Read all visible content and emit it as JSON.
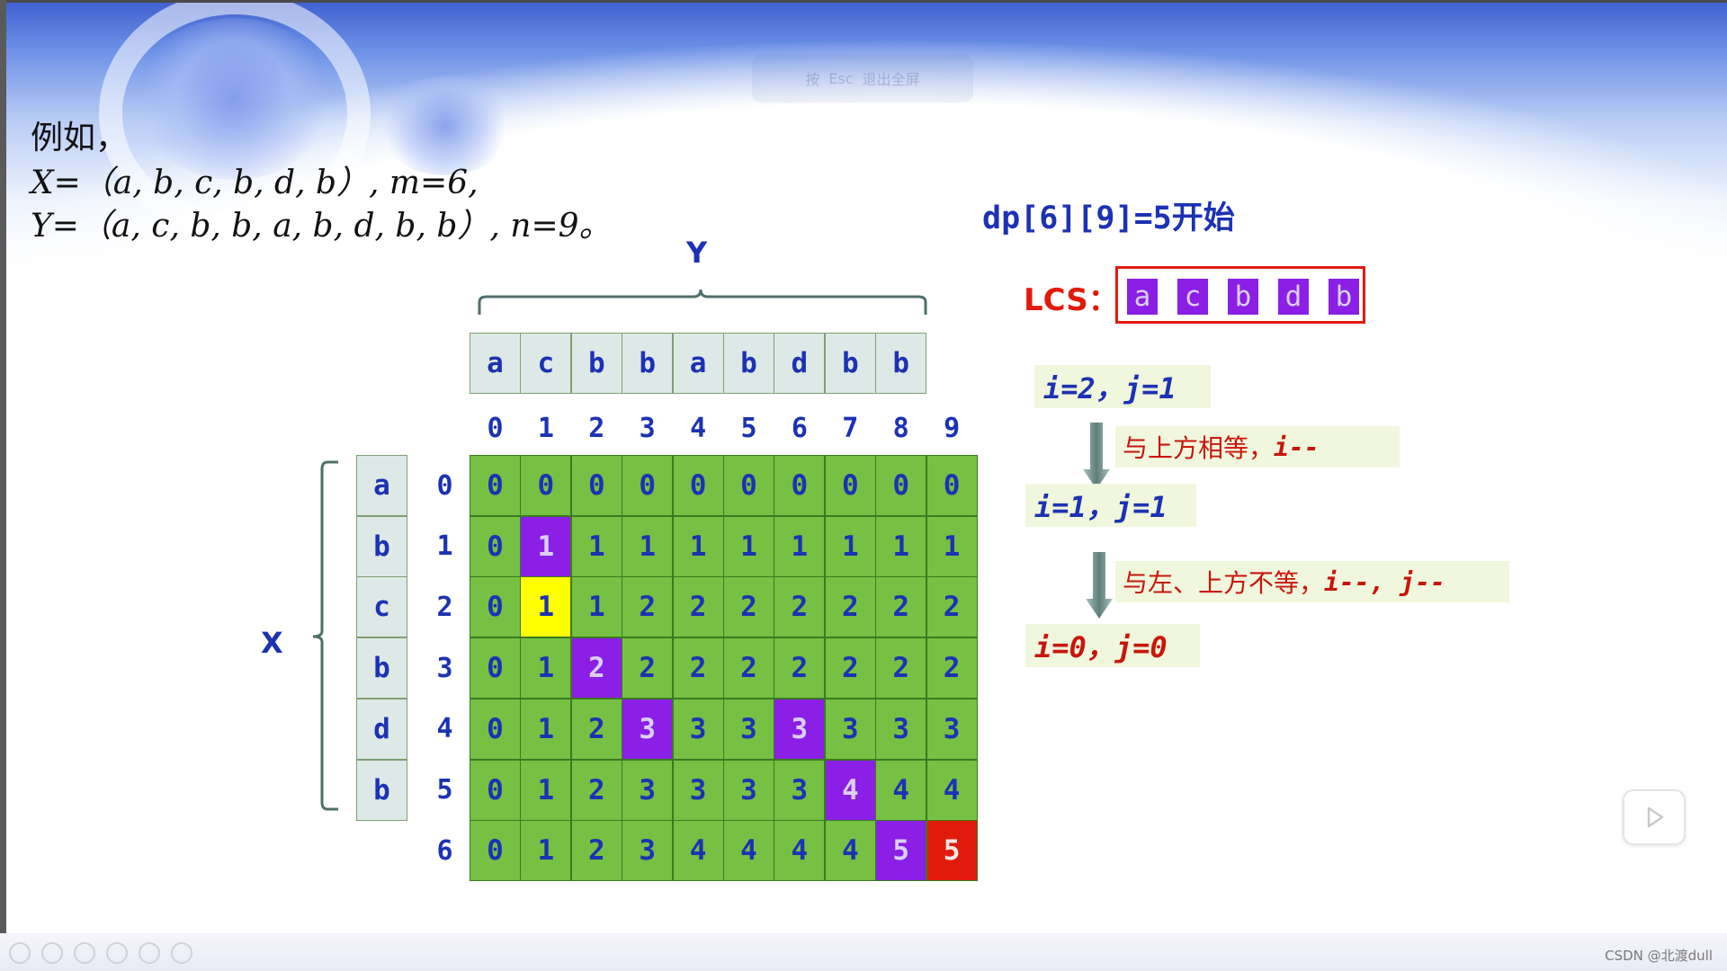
{
  "statement": {
    "title": "例如，",
    "x_line": "X=（a, b, c, b, d, b）, m=6,",
    "y_line": "Y=（a, c, b, b, a, b, d, b, b）, n=9。"
  },
  "overlay_text": [
    "按",
    "Esc",
    "退出全屏"
  ],
  "axis": {
    "y_label": "Y",
    "x_label": "X"
  },
  "y_sequence": [
    "a",
    "c",
    "b",
    "b",
    "a",
    "b",
    "d",
    "b",
    "b"
  ],
  "x_sequence": [
    "a",
    "b",
    "c",
    "b",
    "d",
    "b"
  ],
  "col_indices": [
    "0",
    "1",
    "2",
    "3",
    "4",
    "5",
    "6",
    "7",
    "8",
    "9"
  ],
  "row_indices": [
    "0",
    "1",
    "2",
    "3",
    "4",
    "5",
    "6"
  ],
  "dp_table": [
    [
      "0",
      "0",
      "0",
      "0",
      "0",
      "0",
      "0",
      "0",
      "0",
      "0"
    ],
    [
      "0",
      "1",
      "1",
      "1",
      "1",
      "1",
      "1",
      "1",
      "1",
      "1"
    ],
    [
      "0",
      "1",
      "1",
      "2",
      "2",
      "2",
      "2",
      "2",
      "2",
      "2"
    ],
    [
      "0",
      "1",
      "2",
      "2",
      "2",
      "2",
      "2",
      "2",
      "2",
      "2"
    ],
    [
      "0",
      "1",
      "2",
      "3",
      "3",
      "3",
      "3",
      "3",
      "3",
      "3"
    ],
    [
      "0",
      "1",
      "2",
      "3",
      "3",
      "3",
      "3",
      "4",
      "4",
      "4"
    ],
    [
      "0",
      "1",
      "2",
      "3",
      "4",
      "4",
      "4",
      "4",
      "5",
      "5"
    ]
  ],
  "highlights": {
    "purple": [
      [
        1,
        1
      ],
      [
        3,
        2
      ],
      [
        4,
        3
      ],
      [
        4,
        6
      ],
      [
        5,
        7
      ],
      [
        6,
        8
      ]
    ],
    "yellow": [
      [
        2,
        1
      ]
    ],
    "red": [
      [
        6,
        9
      ]
    ],
    "colors": {
      "cell": "#76c043",
      "purple": "#8b1fe6",
      "yellow": "#ffff00",
      "red": "#e01b0c"
    }
  },
  "dp_start": {
    "expr": "dp[6][9]=5",
    "suffix": "开始"
  },
  "lcs": {
    "label": "LCS：",
    "chars": [
      "a",
      "c",
      "b",
      "d",
      "b"
    ]
  },
  "steps": [
    {
      "text": "i=2，j=1"
    },
    {
      "text": "i=1，j=1"
    },
    {
      "text": "i=0，j=0"
    }
  ],
  "notes": [
    {
      "text": "与上方相等，",
      "op": "i--"
    },
    {
      "text": "与左、上方不等，",
      "op": "i--, j--"
    }
  ],
  "watermark": "CSDN @北渡dull"
}
